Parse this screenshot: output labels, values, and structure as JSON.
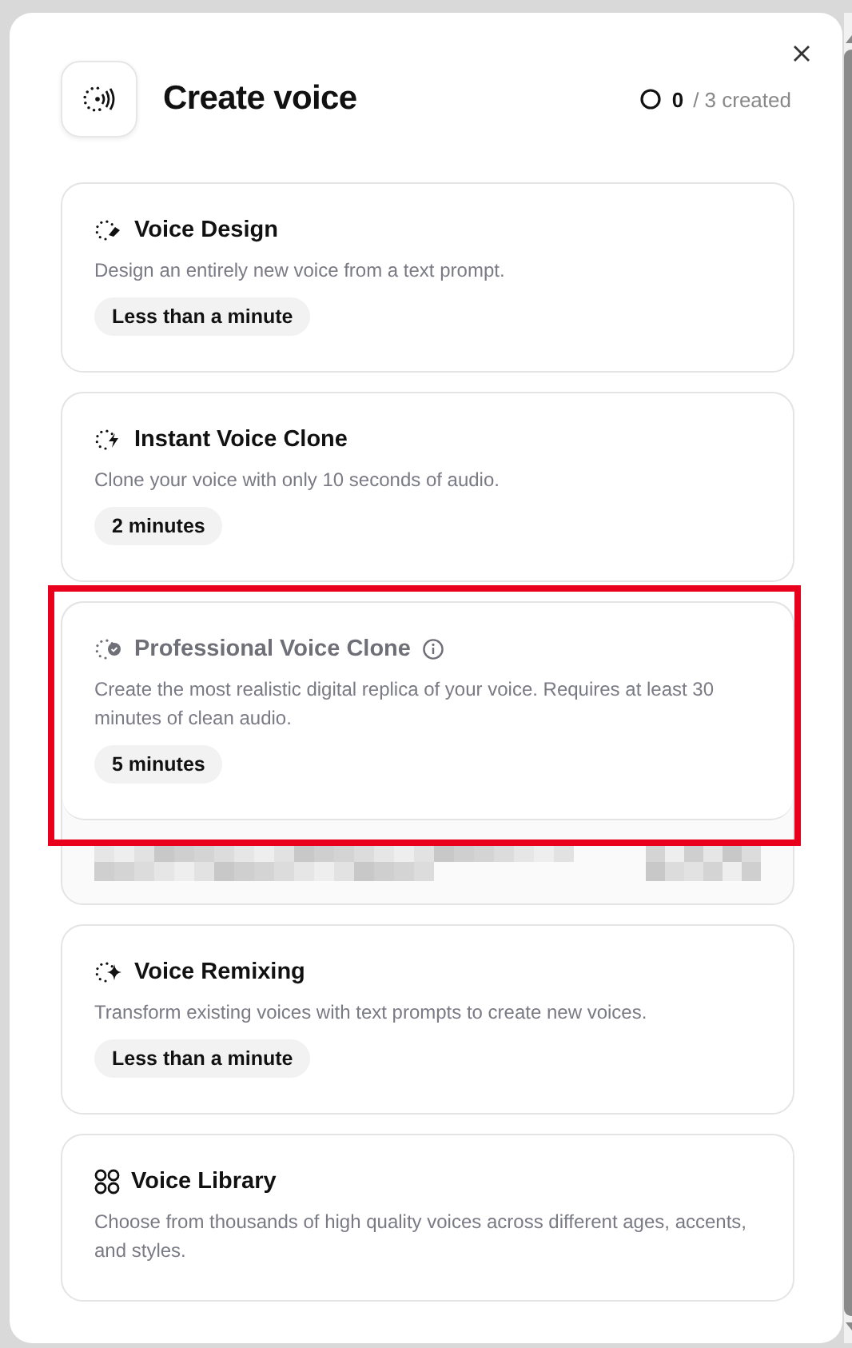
{
  "dialog": {
    "title": "Create voice",
    "counter": {
      "used": "0",
      "rest": "/ 3 created"
    }
  },
  "options": [
    {
      "kind": "design",
      "title": "Voice Design",
      "description": "Design an entirely new voice from a text prompt.",
      "duration": "Less than a minute",
      "disabled": false,
      "info": false,
      "highlighted": false,
      "redacted_footer": false
    },
    {
      "kind": "instant",
      "title": "Instant Voice Clone",
      "description": "Clone your voice with only 10 seconds of audio.",
      "duration": "2 minutes",
      "disabled": false,
      "info": false,
      "highlighted": false,
      "redacted_footer": false
    },
    {
      "kind": "professional",
      "title": "Professional Voice Clone",
      "description": "Create the most realistic digital replica of your voice. Requires at least 30 minutes of clean audio.",
      "duration": "5 minutes",
      "disabled": true,
      "info": true,
      "highlighted": true,
      "redacted_footer": true
    },
    {
      "kind": "remix",
      "title": "Voice Remixing",
      "description": "Transform existing voices with text prompts to create new voices.",
      "duration": "Less than a minute",
      "disabled": false,
      "info": false,
      "highlighted": false,
      "redacted_footer": false
    },
    {
      "kind": "library",
      "title": "Voice Library",
      "description": "Choose from thousands of high quality voices across different ages, accents, and styles.",
      "disabled": false,
      "info": false,
      "highlighted": false,
      "redacted_footer": false
    }
  ]
}
